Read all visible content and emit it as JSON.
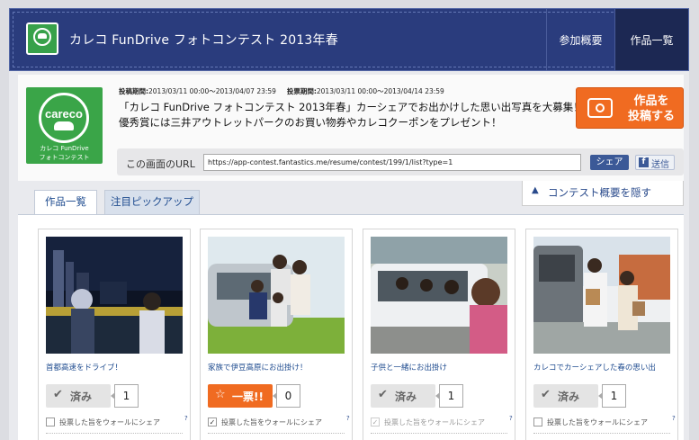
{
  "header": {
    "title": "カレコ FunDrive フォトコンテスト 2013年春",
    "nav": [
      {
        "label": "参加概要"
      },
      {
        "label": "作品一覧"
      }
    ]
  },
  "brand": {
    "logo_text": "careco",
    "line1": "カレコ FunDrive",
    "line2": "フォトコンテスト"
  },
  "contest": {
    "post_period_label": "投稿期間:",
    "post_period": "2013/03/11 00:00〜2013/04/07 23:59",
    "vote_period_label": "投票期間:",
    "vote_period": "2013/03/11 00:00〜2013/04/14 23:59",
    "desc_line1": "「カレコ FunDrive フォトコンテスト 2013年春」カーシェアでお出かけした思い出写真を大募集！",
    "desc_line2": "優秀賞には三井アウトレットパークのお買い物券やカレコクーポンをプレゼント！",
    "post_button": {
      "line1": "作品を",
      "line2": "投稿する"
    }
  },
  "url_bar": {
    "label": "この画面のURL",
    "value": "https://app-contest.fantastics.me/resume/contest/199/1/list?type=1",
    "share_label": "シェア",
    "fb_label": "送信"
  },
  "hide_overview": "コンテスト概要を隠す",
  "tabs": [
    {
      "label": "作品一覧"
    },
    {
      "label": "注目ピックアップ"
    }
  ],
  "cards": [
    {
      "caption": "首都高速をドライブ！",
      "vote_label": "済み",
      "count": "1",
      "share_label": "投票した旨をウォールにシェア",
      "help": "?"
    },
    {
      "caption": "家族で伊豆高原にお出掛け！",
      "vote_label": "一票!!",
      "count": "0",
      "share_label": "投票した旨をウォールにシェア",
      "help": "?"
    },
    {
      "caption": "子供と一緒にお出掛け",
      "vote_label": "済み",
      "count": "1",
      "share_label": "投票した旨をウォールにシェア",
      "help": "?"
    },
    {
      "caption": "カレコでカーシェアした春の思い出",
      "vote_label": "済み",
      "count": "1",
      "share_label": "投票した旨をウォールにシェア",
      "help": "?"
    }
  ],
  "colors": {
    "header_bg": "#2a3c7d",
    "accent_orange": "#f06b21",
    "brand_green": "#3aa548",
    "link_blue": "#1e4b8f",
    "facebook_blue": "#3b5997"
  }
}
